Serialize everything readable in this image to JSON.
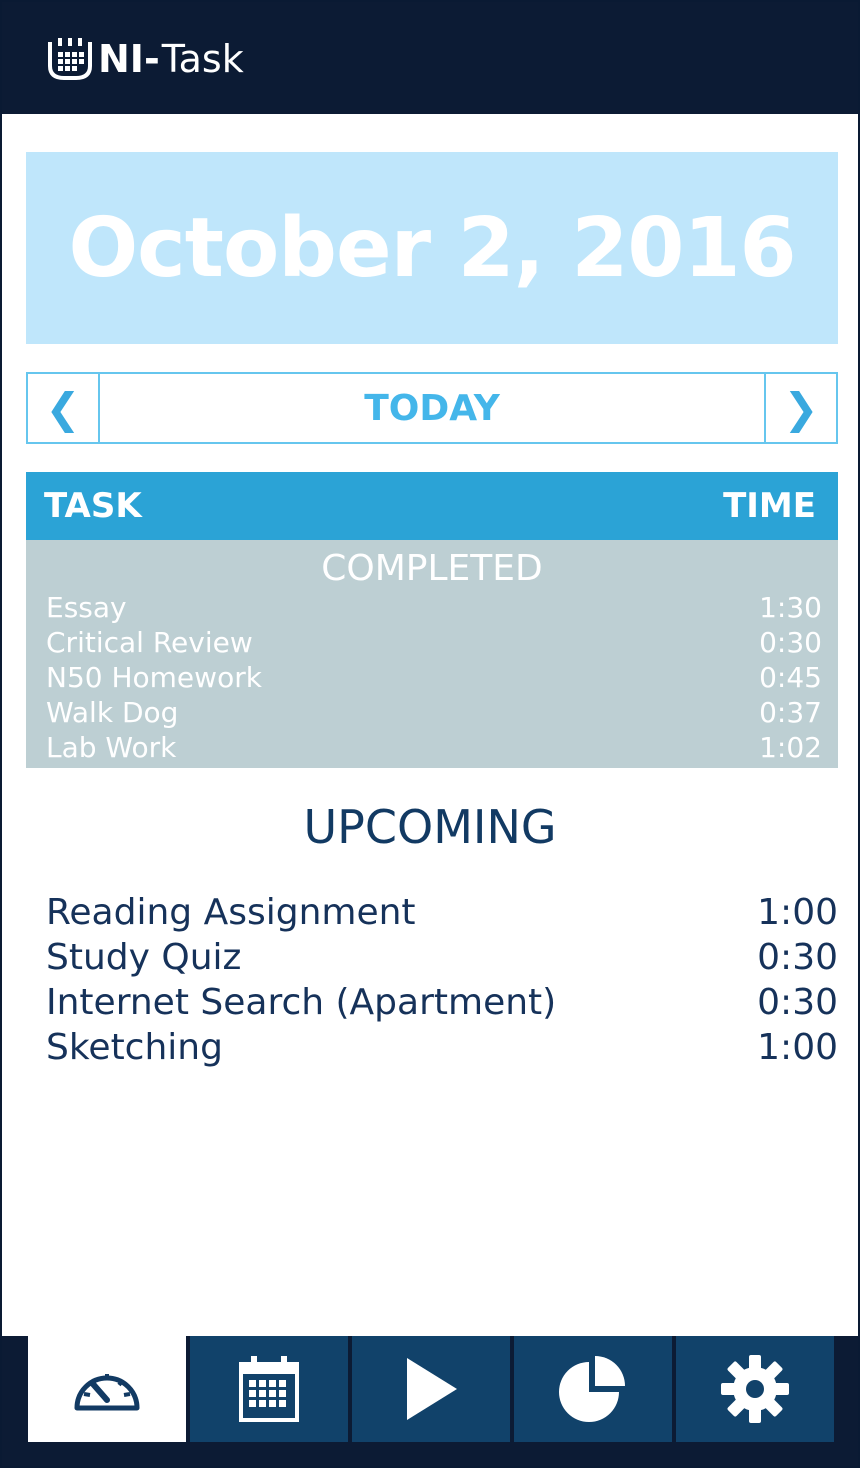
{
  "app": {
    "logo_ni": "NI-",
    "logo_task": "Task"
  },
  "date": {
    "label": "October 2, 2016"
  },
  "day_nav": {
    "prev_icon": "chevron-left-icon",
    "prev_glyph": "❮",
    "label": "TODAY",
    "next_icon": "chevron-right-icon",
    "next_glyph": "❯"
  },
  "table": {
    "task_header": "TASK",
    "time_header": "TIME"
  },
  "completed": {
    "title": "COMPLETED",
    "items": [
      {
        "task": "Essay",
        "time": "1:30"
      },
      {
        "task": "Critical Review",
        "time": "0:30"
      },
      {
        "task": "N50 Homework",
        "time": "0:45"
      },
      {
        "task": "Walk Dog",
        "time": "0:37"
      },
      {
        "task": "Lab Work",
        "time": "1:02"
      }
    ]
  },
  "upcoming": {
    "title": "UPCOMING",
    "items": [
      {
        "task": "Reading Assignment",
        "time": "1:00"
      },
      {
        "task": "Study Quiz",
        "time": "0:30"
      },
      {
        "task": "Internet Search (Apartment)",
        "time": "0:30"
      },
      {
        "task": "Sketching",
        "time": "1:00"
      }
    ]
  },
  "bottom_nav": {
    "tabs": [
      {
        "icon": "speedometer-icon",
        "active": true
      },
      {
        "icon": "calendar-icon",
        "active": false
      },
      {
        "icon": "play-icon",
        "active": false
      },
      {
        "icon": "pie-chart-icon",
        "active": false
      },
      {
        "icon": "gear-icon",
        "active": false
      }
    ]
  },
  "colors": {
    "header_bg": "#0c1b34",
    "date_banner_bg": "#bfe6fb",
    "accent_blue": "#2ba3d6",
    "completed_bg": "#bdcfd3",
    "upcoming_text": "#16325a",
    "tab_bg": "#11426a"
  }
}
